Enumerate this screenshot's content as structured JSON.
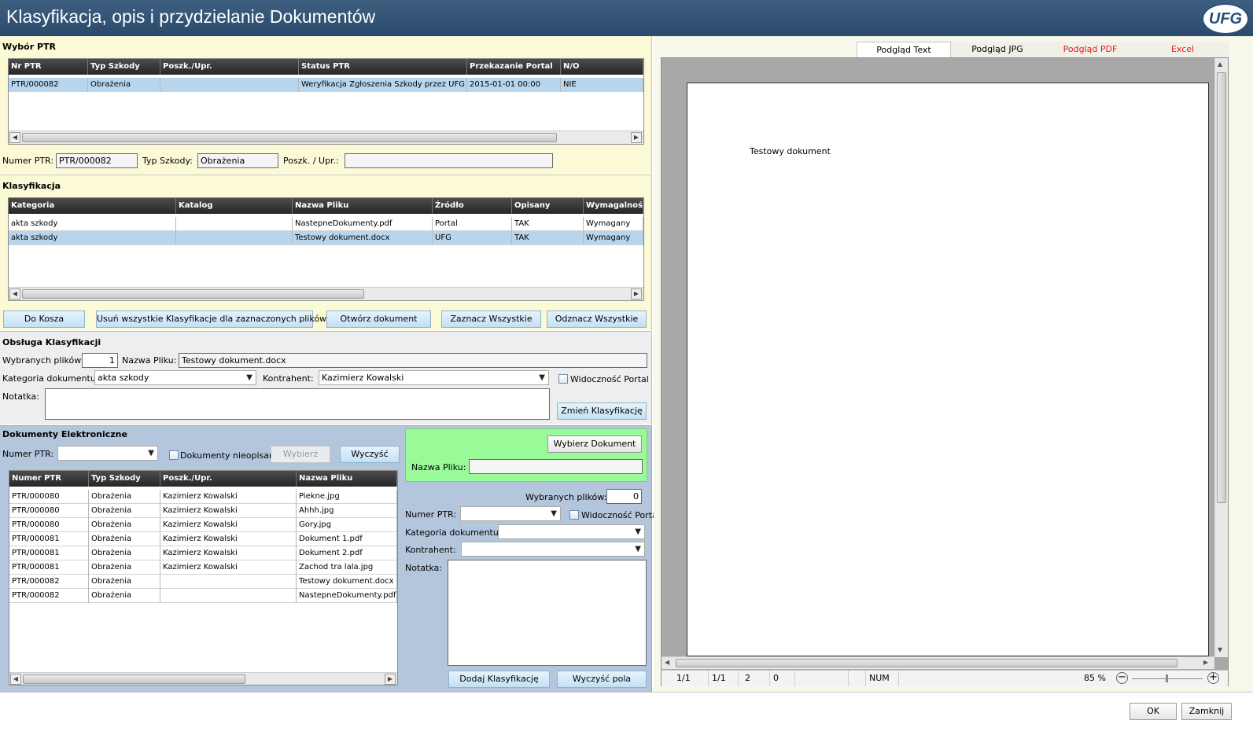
{
  "app": {
    "title": "Klasyfikacja, opis i przydzielanie Dokumentów",
    "logo_text": "UFG"
  },
  "wybor": {
    "section": "Wybór PTR",
    "columns": [
      "Nr PTR",
      "Typ Szkody",
      "Poszk./Upr.",
      "Status PTR",
      "Przekazanie Portal",
      "N/O"
    ],
    "rows": [
      [
        "PTR/000082",
        "Obrażenia",
        "",
        "Weryfikacja Zgłoszenia Szkody przez UFG",
        "2015-01-01 00:00",
        "NIE"
      ]
    ],
    "numer_label": "Numer PTR:",
    "numer_value": "PTR/000082",
    "typ_label": "Typ Szkody:",
    "typ_value": "Obrażenia",
    "poszk_label": "Poszk. / Upr.:",
    "poszk_value": ""
  },
  "klas": {
    "section": "Klasyfikacja",
    "columns": [
      "Kategoria",
      "Katalog",
      "Nazwa Pliku",
      "Źródło",
      "Opisany",
      "Wymagalność"
    ],
    "rows": [
      [
        "akta szkody",
        "",
        "NastepneDokumenty.pdf",
        "Portal",
        "TAK",
        "Wymagany"
      ],
      [
        "akta szkody",
        "",
        "Testowy dokument.docx",
        "UFG",
        "TAK",
        "Wymagany"
      ]
    ],
    "buttons": [
      "Do Kosza",
      "Usuń wszystkie Klasyfikacje dla zaznaczonych plików",
      "Otwórz dokument",
      "Zaznacz Wszystkie",
      "Odznacz Wszystkie"
    ]
  },
  "obsluga": {
    "section": "Obsługa Klasyfikacji",
    "wybranych_label": "Wybranych plików:",
    "wybranych_value": "1",
    "nazwa_label": "Nazwa Pliku:",
    "nazwa_value": "Testowy dokument.docx",
    "kategoria_label": "Kategoria dokumentu:",
    "kategoria_value": "akta szkody",
    "kontrahent_label": "Kontrahent:",
    "kontrahent_value": "Kazimierz Kowalski",
    "widocznosc_label": "Widoczność Portal",
    "notatka_label": "Notatka:",
    "zmien_button": "Zmień Klasyfikację"
  },
  "dok": {
    "section": "Dokumenty Elektroniczne",
    "numer_label": "Numer PTR:",
    "nieopisane_label": "Dokumenty nieopisane",
    "wybierz_button": "Wybierz",
    "wyczysc_button": "Wyczyść",
    "columns": [
      "Numer PTR",
      "Typ Szkody",
      "Poszk./Upr.",
      "Nazwa Pliku"
    ],
    "rows": [
      [
        "PTR/000080",
        "Obrażenia",
        "Kazimierz Kowalski",
        "Piekne.jpg"
      ],
      [
        "PTR/000080",
        "Obrażenia",
        "Kazimierz Kowalski",
        "Ahhh.jpg"
      ],
      [
        "PTR/000080",
        "Obrażenia",
        "Kazimierz Kowalski",
        "Gory.jpg"
      ],
      [
        "PTR/000081",
        "Obrażenia",
        "Kazimierz Kowalski",
        "Dokument 1.pdf"
      ],
      [
        "PTR/000081",
        "Obrażenia",
        "Kazimierz Kowalski",
        "Dokument 2.pdf"
      ],
      [
        "PTR/000081",
        "Obrażenia",
        "Kazimierz Kowalski",
        "Zachod tra lala.jpg"
      ],
      [
        "PTR/000082",
        "Obrażenia",
        "",
        "Testowy dokument.docx"
      ],
      [
        "PTR/000082",
        "Obrażenia",
        "",
        "NastepneDokumenty.pdf"
      ]
    ]
  },
  "right": {
    "wybierz_dok_button": "Wybierz Dokument",
    "nazwa_label": "Nazwa Pliku:",
    "wybranych_label": "Wybranych plików:",
    "wybranych_value": "0",
    "numer_label": "Numer PTR:",
    "widocznosc_label": "Widoczność Portal",
    "kategoria_label": "Kategoria dokumentu:",
    "kontrahent_label": "Kontrahent:",
    "notatka_label": "Notatka:",
    "dodaj_button": "Dodaj Klasyfikację",
    "wyczysc_pola_button": "Wyczyść pola"
  },
  "preview": {
    "tabs": [
      "Podgląd Text",
      "Podgląd JPG",
      "Podgląd PDF",
      "Excel"
    ],
    "document_text": "Testowy dokument",
    "status": [
      "1/1",
      "1/1",
      "2",
      "0",
      "",
      "",
      "NUM"
    ],
    "zoom": "85 %"
  },
  "footer": {
    "ok": "OK",
    "zamknij": "Zamknij"
  },
  "colors": {
    "title_bar": "#2f5070",
    "selected_row": "#b7d6ee",
    "green_panel": "#98fb98",
    "tab_red": "#e02020"
  }
}
